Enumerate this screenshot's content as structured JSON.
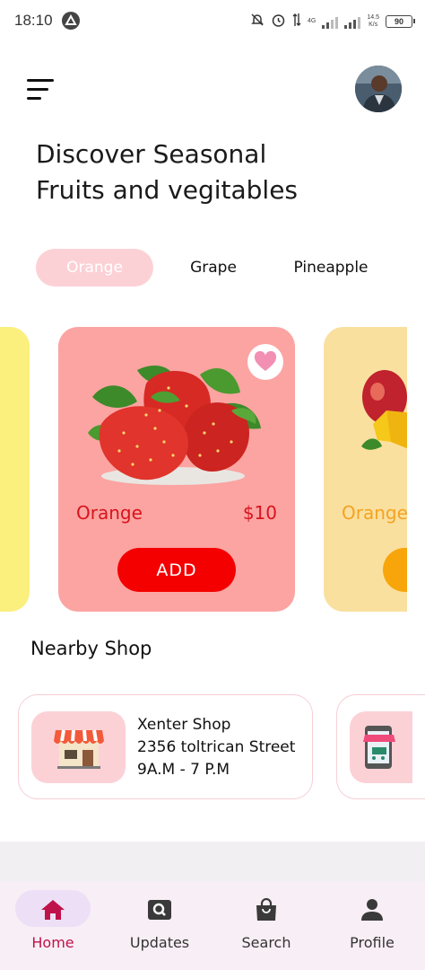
{
  "status_bar": {
    "time": "18:10",
    "net_speed": "14.5",
    "net_unit": "K/s",
    "network": "4G",
    "battery": "90"
  },
  "header": {
    "menu_icon": "hamburger-menu-icon",
    "avatar": "user-avatar"
  },
  "title": {
    "line1": "Discover Seasonal",
    "line2": "Fruits and vegitables"
  },
  "categories": [
    {
      "label": "Orange",
      "active": true
    },
    {
      "label": "Grape",
      "active": false
    },
    {
      "label": "Pineapple",
      "active": false
    }
  ],
  "products": {
    "main": {
      "name": "Orange",
      "price": "$10",
      "button": "ADD",
      "image": "strawberries",
      "card_color": "#fba4a2",
      "accent": "#d8141c",
      "button_color": "#f40000"
    },
    "next": {
      "name": "Orange",
      "image": "mango",
      "card_color": "#fae09f",
      "accent": "#f4a321"
    },
    "prev": {
      "card_color": "#fbef7e"
    }
  },
  "nearby": {
    "title": "Nearby Shop",
    "shops": [
      {
        "name": "Xenter Shop",
        "address": "2356 toltrican Street",
        "hours": "9A.M - 7 P.M",
        "icon": "storefront-icon"
      },
      {
        "icon": "online-shop-icon"
      }
    ]
  },
  "bottom_nav": [
    {
      "label": "Home",
      "icon": "home-icon",
      "active": true
    },
    {
      "label": "Updates",
      "icon": "updates-icon",
      "active": false
    },
    {
      "label": "Search",
      "icon": "shopping-bag-icon",
      "active": false
    },
    {
      "label": "Profile",
      "icon": "person-icon",
      "active": false
    }
  ],
  "colors": {
    "active_tab_bg": "#fcd1d6",
    "nav_active": "#c0124a",
    "nav_bg": "#f8eef5"
  }
}
